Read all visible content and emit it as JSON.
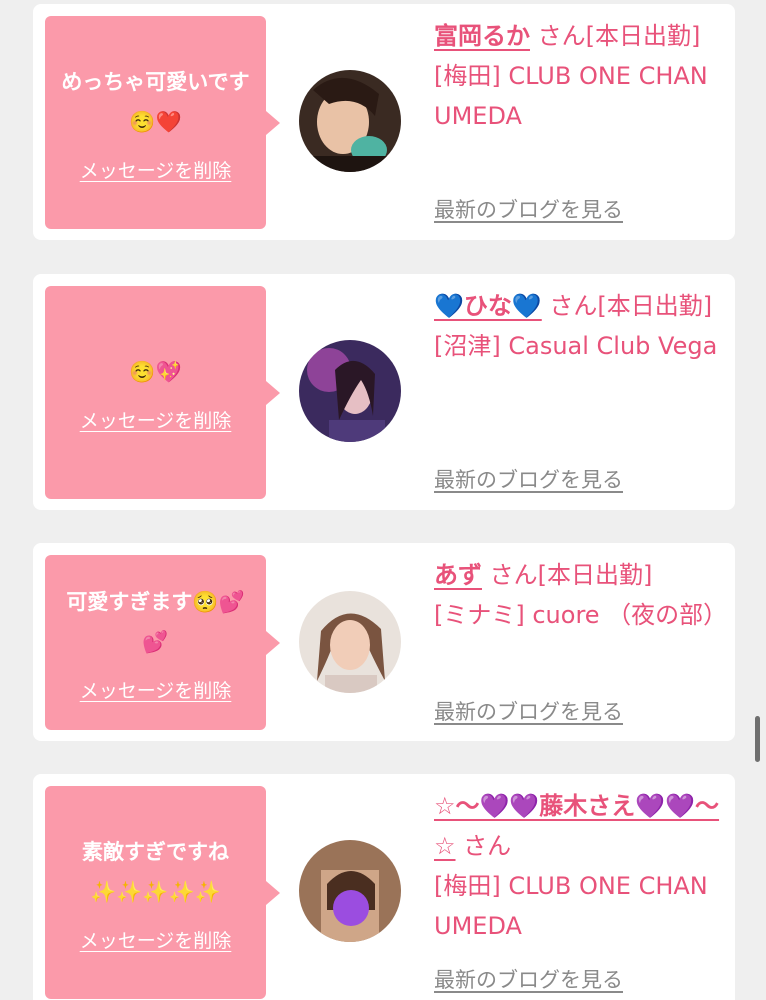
{
  "colors": {
    "bubble": "#fb9aaa",
    "accent": "#e8527a",
    "link_gray": "#8a8a8a",
    "background": "#efefef"
  },
  "cards": [
    {
      "message": "めっちゃ可愛いです☺️❤️",
      "delete_label": "メッセージを削除",
      "name": "富岡るか",
      "suffix": "さん[本日出勤]",
      "shop": "[梅田] CLUB ONE CHAN UMEDA",
      "blog_label": "最新のブログを見る",
      "avatar": "avatar-photo-1"
    },
    {
      "message": "☺️💖",
      "delete_label": "メッセージを削除",
      "name": "💙ひな💙",
      "suffix": "さん[本日出勤]",
      "shop": "[沼津] Casual Club Vega",
      "blog_label": "最新のブログを見る",
      "avatar": "avatar-photo-2"
    },
    {
      "message": "可愛すぎます🥺💕💕",
      "delete_label": "メッセージを削除",
      "name": "あず",
      "suffix": "さん[本日出勤]",
      "shop": "[ミナミ] cuore （夜の部）",
      "blog_label": "最新のブログを見る",
      "avatar": "avatar-photo-3"
    },
    {
      "message": "素敵すぎですね✨✨✨✨✨",
      "delete_label": "メッセージを削除",
      "name": "☆〜💜💜藤木さえ💜💜〜☆",
      "suffix": "さん",
      "shop": "[梅田] CLUB ONE CHAN UMEDA",
      "blog_label": "最新のブログを見る",
      "avatar": "avatar-photo-4"
    }
  ]
}
